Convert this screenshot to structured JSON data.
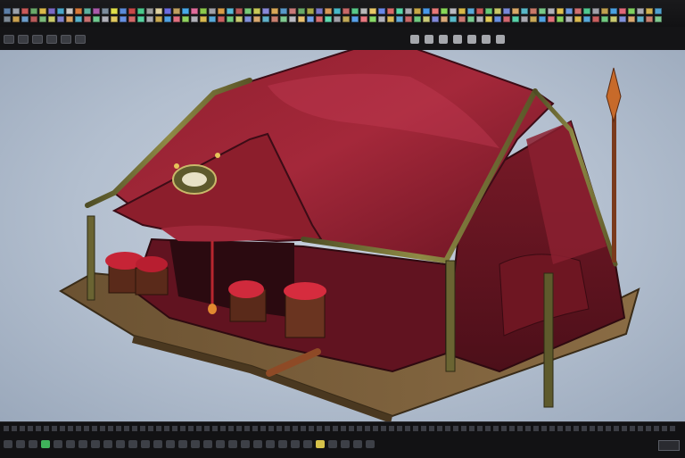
{
  "app": {
    "accent": "#e5a43a"
  },
  "shelf": {
    "row1_colors": [
      "#5c7fa8",
      "#9aa0aa",
      "#c95a5a",
      "#6aa96a",
      "#d9b84a",
      "#7b68c4",
      "#4aa6c9",
      "#c6c6c6",
      "#d87a3a",
      "#5db2a0",
      "#aa5aaa",
      "#7c8c9c",
      "#e0e04a",
      "#5a8ad8",
      "#c84848",
      "#4ac88c",
      "#9c9c9c",
      "#ded0a0",
      "#6c6ce0",
      "#c0a060",
      "#48a8e8",
      "#e06c9c",
      "#8cc84c",
      "#a0a0a8",
      "#d89c48",
      "#58b8d8",
      "#b85858",
      "#78c878",
      "#c8c858",
      "#8888d8",
      "#d8a858",
      "#5898c8",
      "#c87878",
      "#68a868",
      "#a8a848",
      "#7878c8",
      "#d89858",
      "#48b8c8",
      "#c86868",
      "#58c888",
      "#b8b8b8",
      "#e8c868",
      "#6888e8",
      "#d86868",
      "#58d8a8",
      "#a8a8b0",
      "#c8a848",
      "#4898e8",
      "#e87878",
      "#88d858",
      "#b8b8c0",
      "#d8b848",
      "#58a8d8",
      "#c85858",
      "#68c878",
      "#c8c868",
      "#7888d8",
      "#d8a868",
      "#58b8c8",
      "#c87868",
      "#78c888",
      "#b0b0b8",
      "#e0c050",
      "#6898e0",
      "#d07070",
      "#50c890",
      "#a0a0a8",
      "#c0a050",
      "#4aa0e0",
      "#e06878",
      "#80d060",
      "#a8a8b0",
      "#d0b050",
      "#50a0d0"
    ],
    "row2_colors": [
      "#7c8894",
      "#c8a050",
      "#6c9cc8",
      "#b85a5a",
      "#7ab87a",
      "#c8c86a",
      "#8080c8",
      "#d8a060",
      "#58b0c8",
      "#c87070",
      "#70c890",
      "#b0b0b8",
      "#e0c860",
      "#6890e0",
      "#d06868",
      "#58d0a0",
      "#a8a8b0",
      "#c8a850",
      "#50a0e0",
      "#e07080",
      "#90d060",
      "#b0b0b8",
      "#d8b850",
      "#58a8d8",
      "#c86060",
      "#70c880",
      "#c8c870",
      "#8090d8",
      "#d8a870",
      "#60b0c8",
      "#c88070",
      "#80c890",
      "#b8b8c0",
      "#e8c070",
      "#70a0e8",
      "#d87070",
      "#60d8b0",
      "#a0a0a8",
      "#c0a858",
      "#58a0e8",
      "#e87880",
      "#88d868",
      "#b0b0b8",
      "#d8b858",
      "#60a8d8",
      "#c86868",
      "#70c880",
      "#c8c878",
      "#8088d8",
      "#d8a878",
      "#58b8c8",
      "#c87870",
      "#78c890",
      "#b0b0b8",
      "#e0c858",
      "#6890e0",
      "#d06870",
      "#58d0a8",
      "#a8a8b0",
      "#c8a858",
      "#50a0e0",
      "#e07078",
      "#88d060",
      "#b0b0b8",
      "#d8b850",
      "#58a8d8",
      "#c86060",
      "#70c880",
      "#c8c870",
      "#8090d8",
      "#d8a870",
      "#60b0c8",
      "#c88070",
      "#80c890"
    ]
  },
  "toolbar": {
    "left_count": 6,
    "right_count": 7
  },
  "viewport": {
    "background_color": "#b7c2d1",
    "model": "red-tent-market-stall"
  },
  "timeline": {
    "bottom_highlight_colors": [
      "#3fb25a",
      "#d6c24a"
    ]
  }
}
